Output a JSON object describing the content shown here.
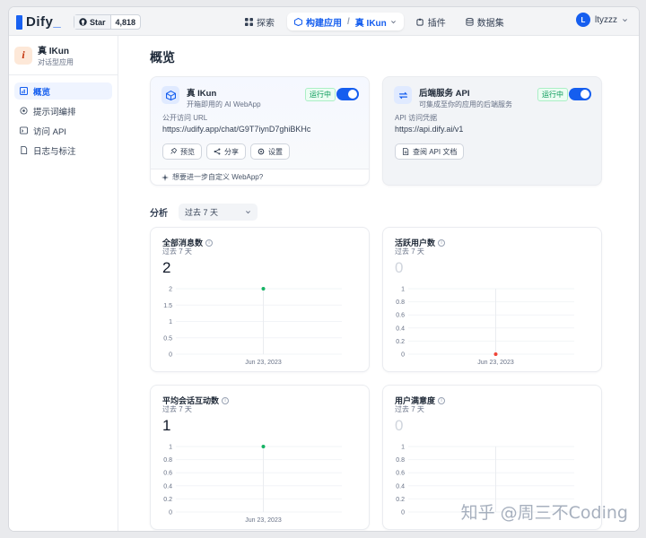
{
  "header": {
    "logo": "Dify",
    "github": {
      "star_label": "Star",
      "count": "4,818"
    },
    "nav": [
      {
        "label": "探索",
        "icon": "grid-icon"
      },
      {
        "label": "构建应用",
        "icon": "cube-icon"
      },
      {
        "label": "真 IKun",
        "icon": "chevron-down-icon"
      },
      {
        "label": "插件",
        "icon": "puzzle-icon"
      },
      {
        "label": "数据集",
        "icon": "database-icon"
      }
    ],
    "user": {
      "initial": "L",
      "name": "ltyzzz"
    }
  },
  "sidebar": {
    "app": {
      "name": "真 IKun",
      "type": "对话型应用",
      "icon_letter": "i"
    },
    "items": [
      {
        "label": "概览",
        "icon": "overview-icon",
        "active": true
      },
      {
        "label": "提示词编排",
        "icon": "target-icon"
      },
      {
        "label": "访问 API",
        "icon": "terminal-icon"
      },
      {
        "label": "日志与标注",
        "icon": "file-icon"
      }
    ]
  },
  "main": {
    "title": "概览",
    "webapp_card": {
      "title": "真 IKun",
      "subtitle": "开箱即用的 AI WebApp",
      "status": "运行中",
      "url_label": "公开访问 URL",
      "url": "https://udify.app/chat/G9T7iynD7ghiBKHc",
      "buttons": {
        "preview": "预览",
        "share": "分享",
        "settings": "设置"
      },
      "footer": "想要进一步自定义 WebApp?"
    },
    "api_card": {
      "title": "后端服务 API",
      "subtitle": "可集成至你的应用的后端服务",
      "status": "运行中",
      "url_label": "API 访问凭据",
      "url": "https://api.dify.ai/v1",
      "button": "查阅 API 文档"
    },
    "analysis": {
      "label": "分析",
      "range_select": "过去 7 天"
    },
    "stats": [
      {
        "title": "全部消息数",
        "range": "过去 7 天",
        "value": "2"
      },
      {
        "title": "活跃用户数",
        "range": "过去 7 天",
        "value": "0"
      },
      {
        "title": "平均会话互动数",
        "range": "过去 7 天",
        "value": "1"
      },
      {
        "title": "用户满意度",
        "range": "过去 7 天",
        "value": "0"
      }
    ]
  },
  "chart_data": [
    {
      "type": "scatter",
      "title": "全部消息数",
      "x": [
        "Jun 23, 2023"
      ],
      "y": [
        2
      ],
      "yticks": [
        "0",
        "0.5",
        "1",
        "1.5",
        "2"
      ],
      "ylim": [
        0,
        2
      ],
      "point_color": "#16b364"
    },
    {
      "type": "scatter",
      "title": "活跃用户数",
      "x": [
        "Jun 23, 2023"
      ],
      "y": [
        0
      ],
      "yticks": [
        "0",
        "0.2",
        "0.4",
        "0.6",
        "0.8",
        "1"
      ],
      "ylim": [
        0,
        1
      ],
      "point_color": "#f04438"
    },
    {
      "type": "scatter",
      "title": "平均会话互动数",
      "x": [
        "Jun 23, 2023"
      ],
      "y": [
        1
      ],
      "yticks": [
        "0",
        "0.2",
        "0.4",
        "0.6",
        "0.8",
        "1"
      ],
      "ylim": [
        0,
        1
      ],
      "point_color": "#16b364"
    },
    {
      "type": "scatter",
      "title": "用户满意度",
      "x": [],
      "y": [],
      "yticks": [
        "0",
        "0.2",
        "0.4",
        "0.6",
        "0.8",
        "1"
      ],
      "ylim": [
        0,
        1
      ],
      "point_color": "#16b364"
    }
  ],
  "watermark": "知乎 @周三不Coding"
}
